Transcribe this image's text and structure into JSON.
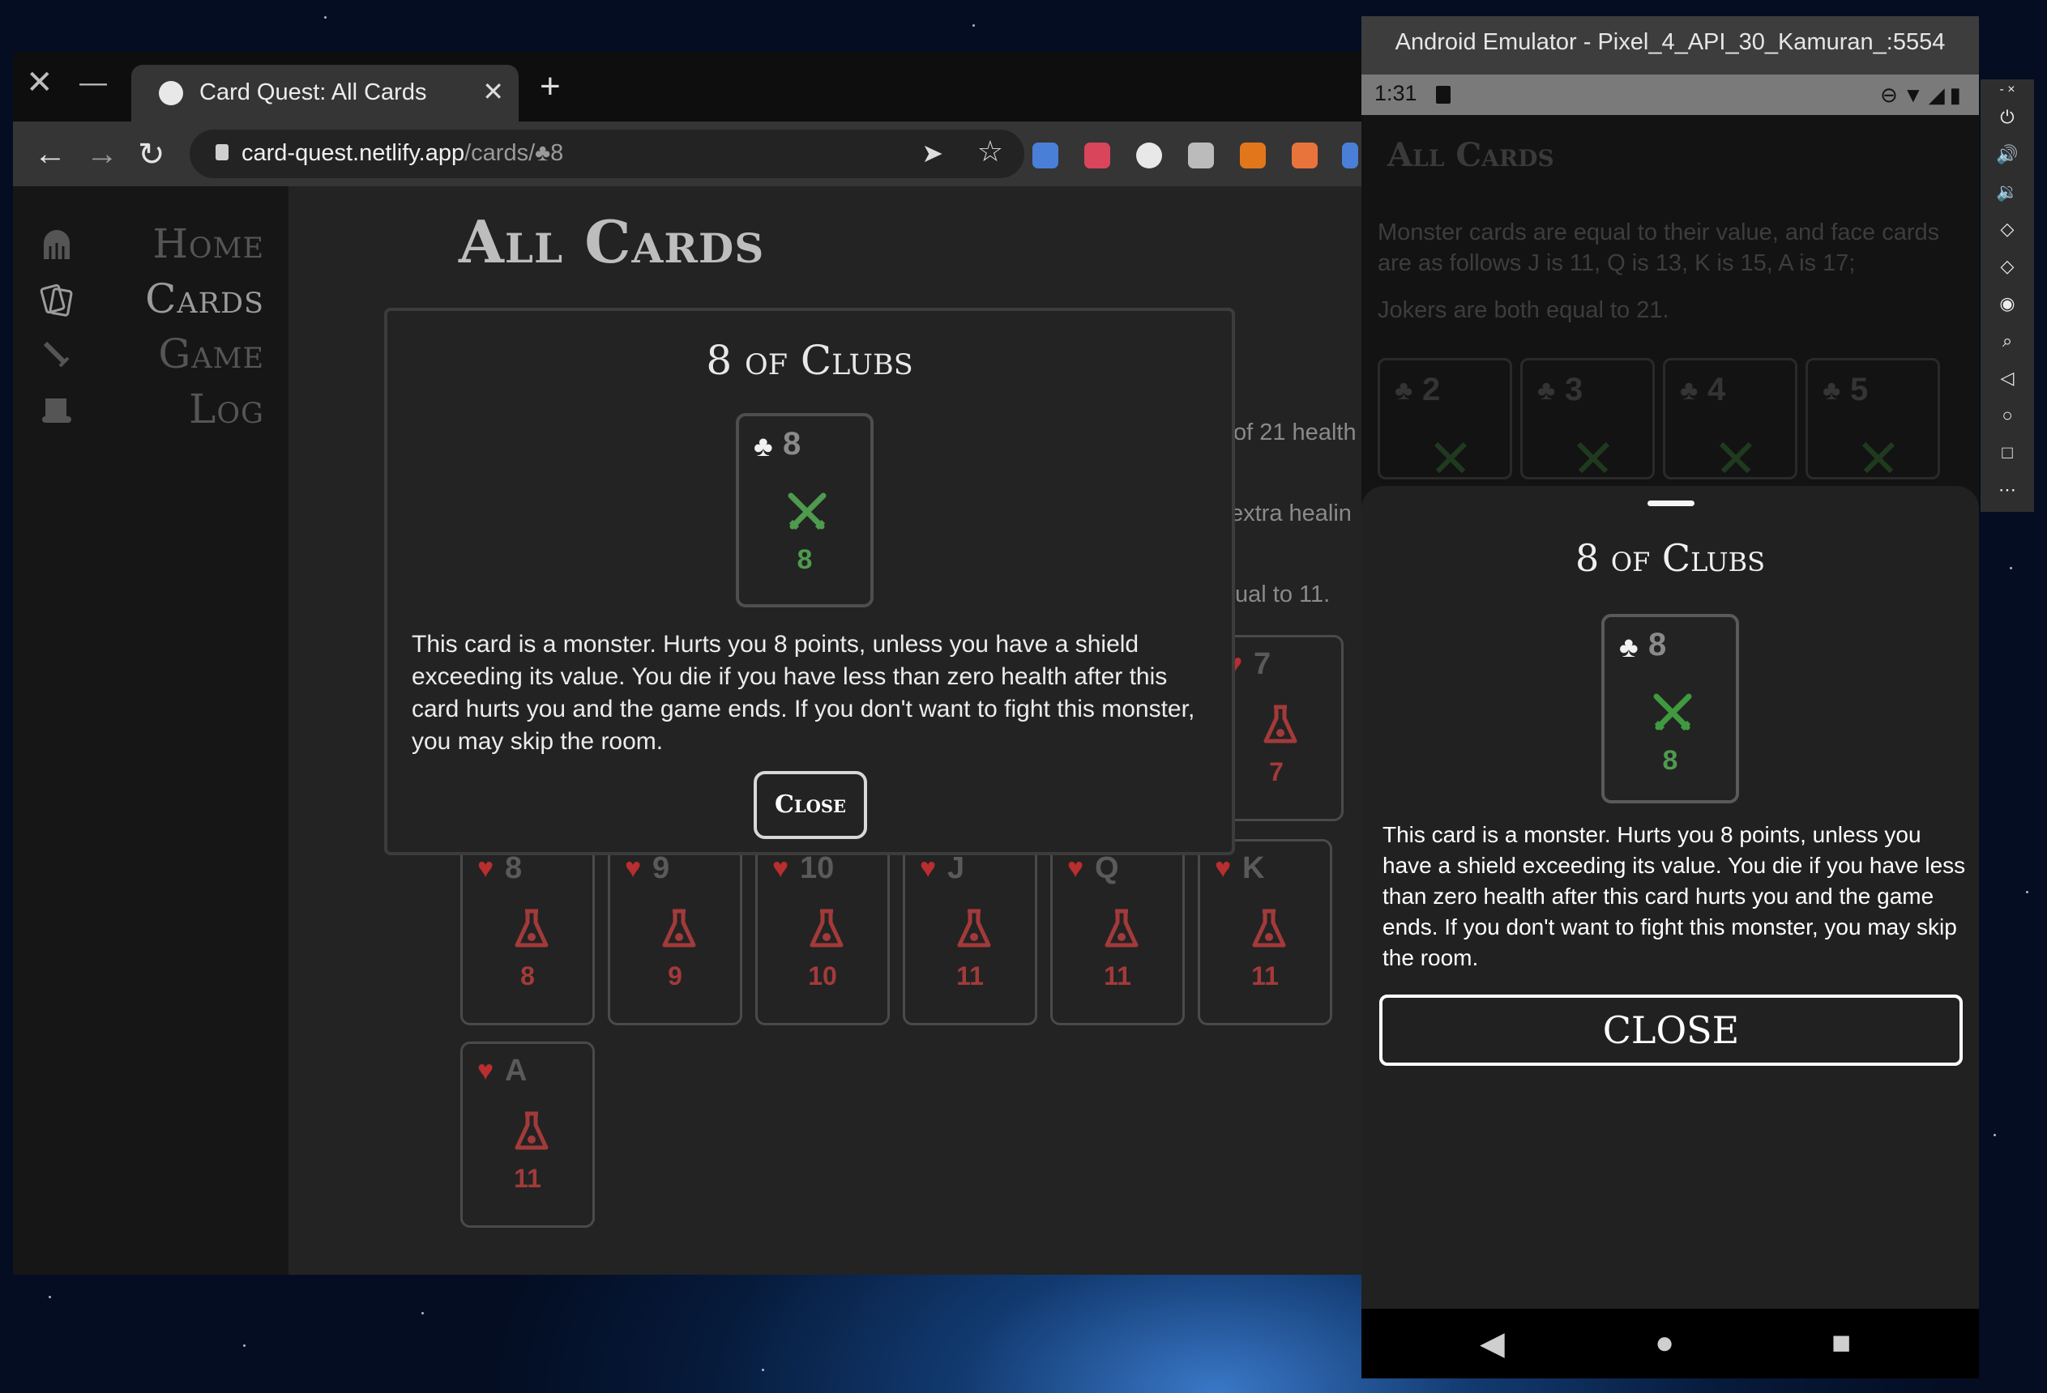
{
  "browser": {
    "tab_title": "Card Quest: All Cards",
    "new_tab": "+",
    "tab_close": "✕",
    "window_close": "✕",
    "window_minimize": "—",
    "url_host": "card-quest.netlify.app",
    "url_path": "/cards/♣8"
  },
  "sidebar": {
    "items": [
      {
        "label": "Home",
        "icon": "dungeon-gate-icon"
      },
      {
        "label": "Cards",
        "icon": "cards-icon"
      },
      {
        "label": "Game",
        "icon": "sword-icon"
      },
      {
        "label": "Log",
        "icon": "scroll-icon"
      }
    ]
  },
  "page": {
    "title": "All Cards",
    "partial_lines": [
      "of 21 health",
      "extra healin",
      "ual to 11."
    ]
  },
  "cards": [
    {
      "suit": "♥",
      "rank": "7",
      "value": "7"
    },
    {
      "suit": "♥",
      "rank": "8",
      "value": "8"
    },
    {
      "suit": "♥",
      "rank": "9",
      "value": "9"
    },
    {
      "suit": "♥",
      "rank": "10",
      "value": "10"
    },
    {
      "suit": "♥",
      "rank": "J",
      "value": "11"
    },
    {
      "suit": "♥",
      "rank": "Q",
      "value": "11"
    },
    {
      "suit": "♥",
      "rank": "K",
      "value": "11"
    },
    {
      "suit": "♥",
      "rank": "A",
      "value": "11"
    }
  ],
  "modal": {
    "title": "8 of Clubs",
    "card_suit": "♣",
    "card_rank": "8",
    "card_value": "8",
    "description": "This card is a monster. Hurts you 8 points, unless you have a shield exceeding its value. You die if you have less than zero health after this card hurts you and the game ends. If you don't want to fight this monster, you may skip the room.",
    "close_label": "Close"
  },
  "emulator": {
    "title": "Android Emulator - Pixel_4_API_30_Kamuran_:5554",
    "time": "1:31",
    "page_title": "All Cards",
    "intro_1": "Monster cards are equal to their value, and face cards are as follows J is 11, Q is 13, K is 15, A is 17;",
    "intro_2": "Jokers are both equal to 21.",
    "mini_cards": [
      {
        "suit": "♣",
        "rank": "2"
      },
      {
        "suit": "♣",
        "rank": "3"
      },
      {
        "suit": "♣",
        "rank": "4"
      },
      {
        "suit": "♣",
        "rank": "5"
      }
    ],
    "sheet": {
      "title": "8 of Clubs",
      "card_suit": "♣",
      "card_rank": "8",
      "card_value": "8",
      "description": "This card is a monster. Hurts you 8 points, unless you have a shield exceeding its value. You die if you have less than zero health after this card hurts you and the game ends. If you don't want to fight this monster, you may skip the room.",
      "close_label": "CLOSE"
    },
    "side_controls": [
      "power-icon",
      "volume-up-icon",
      "volume-down-icon",
      "rotate-left-icon",
      "rotate-right-icon",
      "camera-icon",
      "zoom-icon",
      "back-icon",
      "home-icon",
      "overview-icon",
      "more-icon"
    ]
  },
  "colors": {
    "heart": "#b92e2e",
    "monster_green": "#4e9a4e",
    "page_bg": "#232323"
  }
}
